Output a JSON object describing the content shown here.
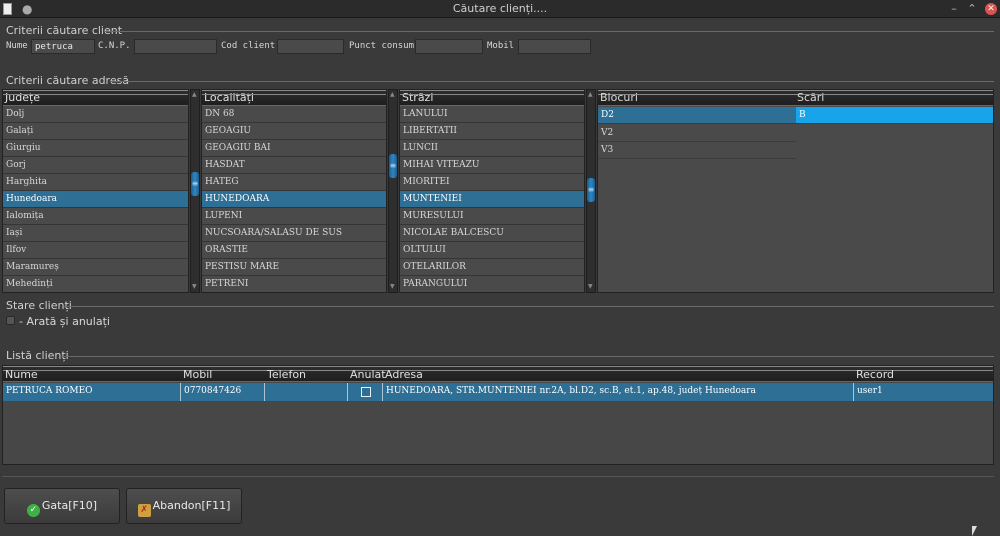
{
  "window": {
    "title": "Căutare clienți....",
    "minimize": "–",
    "maximize": "⌃",
    "close": "✕",
    "menu_dot": "●"
  },
  "criteria_client": {
    "title": "Criterii căutare client",
    "fields": [
      {
        "label": "Nume",
        "value": "petruca"
      },
      {
        "label": "C.N.P.",
        "value": ""
      },
      {
        "label": "Cod client",
        "value": ""
      },
      {
        "label": "Punct consum",
        "value": ""
      },
      {
        "label": "Mobil",
        "value": ""
      }
    ]
  },
  "criteria_address": {
    "title": "Criterii căutare adresă",
    "judete": {
      "header": "Județe",
      "items": [
        "Dolj",
        "Galați",
        "Giurgiu",
        "Gorj",
        "Harghita",
        "Hunedoara",
        "Ialomița",
        "Iași",
        "Ilfov",
        "Maramureș",
        "Mehedinți"
      ],
      "selected_index": 5
    },
    "localitati": {
      "header": "Localități",
      "items": [
        "DN 68",
        "GEOAGIU",
        "GEOAGIU BAI",
        "HASDAT",
        "HATEG",
        "HUNEDOARA",
        "LUPENI",
        "NUCSOARA/SALASU DE SUS",
        "ORASTIE",
        "PESTISU MARE",
        "PETRENI"
      ],
      "selected_index": 5
    },
    "strazi": {
      "header": "Străzi",
      "items": [
        "LANULUI",
        "LIBERTATII",
        "LUNCII",
        "MIHAI VITEAZU",
        "MIORITEI",
        "MUNTENIEI",
        "MURESULUI",
        "NICOLAE BALCESCU",
        "OLTULUI",
        "OTELARILOR",
        "PARANGULUI"
      ],
      "selected_index": 5
    },
    "blocuri": {
      "header": "Blocuri",
      "items": [
        "D2",
        "V2",
        "V3"
      ],
      "selected_index": 0
    },
    "scari": {
      "header": "Scări",
      "items": [
        "B"
      ],
      "selected_index": 0
    }
  },
  "stare_clienti": {
    "title": "Stare clienți",
    "checkbox_label": "- Arată și anulați",
    "checked": false
  },
  "lista_clienti": {
    "title": "Listă clienți",
    "columns": [
      "Nume",
      "Mobil",
      "Telefon",
      "Anulat",
      "Adresa",
      "Record"
    ],
    "rows": [
      {
        "nume": "PETRUCA ROMEO",
        "mobil": "0770847426",
        "telefon": "",
        "anulat": false,
        "adresa": "HUNEDOARA, STR.MUNTENIEI nr.2A, bl.D2, sc.B, et.1, ap.48, județ Hunedoara",
        "record": "user1"
      }
    ]
  },
  "buttons": {
    "ok": "Gata[F10]",
    "abort": "Abandon[F11]"
  },
  "colors": {
    "selection": "#2d6f95",
    "selection_active": "#18a4e8",
    "accent": "#2f86c3"
  }
}
